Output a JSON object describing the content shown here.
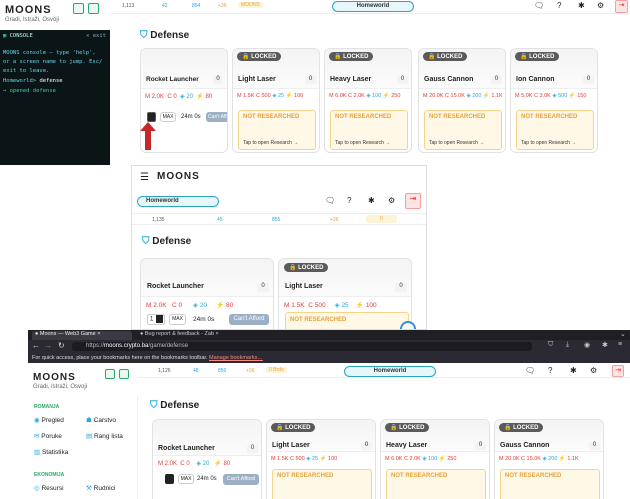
{
  "shot1": {
    "brand": "MOONS",
    "sub": "Gradi, Istraži, Osvoji",
    "console": {
      "title": "CONSOLE",
      "exit": "exit",
      "line1": "MOONS console — type 'help',",
      "line2": "or a screen name to jump. Esc/",
      "line3": "exit to leave.",
      "prompt": "Homeworld>",
      "cmd": "defense",
      "out": "→ opened defense"
    },
    "stats": [
      "1,113",
      "42",
      "854",
      "+36",
      "MOONS"
    ],
    "pill": "Homeworld",
    "section": "Defense",
    "cards": [
      {
        "name": "Rocket Launcher",
        "count": "0",
        "costs": [
          "2.0K",
          "0",
          "20",
          "80"
        ]
      },
      {
        "name": "Light Laser",
        "count": "0",
        "locked": "LOCKED",
        "costs": [
          "1.5K",
          "500",
          "25",
          "100"
        ]
      },
      {
        "name": "Heavy Laser",
        "count": "0",
        "locked": "LOCKED",
        "costs": [
          "6.0K",
          "2.0K",
          "100",
          "250"
        ]
      },
      {
        "name": "Gauss Cannon",
        "count": "0",
        "locked": "LOCKED",
        "costs": [
          "20.0K",
          "15.0K",
          "200",
          "1.1K"
        ]
      },
      {
        "name": "Ion Cannon",
        "count": "0",
        "locked": "LOCKED",
        "costs": [
          "5.0K",
          "3.0K",
          "500",
          "150"
        ]
      }
    ],
    "max": "MAX",
    "time": "24m 0s",
    "afford": "Can't Afford",
    "nr": "NOT RESEARCHED",
    "tap": "Tap to open Research →"
  },
  "shot2": {
    "brand": "MOONS",
    "pill": "Homeworld",
    "stats": [
      "1,135",
      "45",
      "855",
      "+36",
      "0"
    ],
    "section": "Defense",
    "cards": [
      {
        "name": "Rocket Launcher",
        "count": "0",
        "costs": [
          "2.0K",
          "0",
          "20",
          "80"
        ]
      },
      {
        "name": "Light Laser",
        "count": "0",
        "locked": "LOCKED",
        "costs": [
          "1.5K",
          "500",
          "25",
          "100"
        ]
      }
    ],
    "qty": "1",
    "max": "MAX",
    "time": "24m 0s",
    "afford": "Can't Afford",
    "nr": "NOT RESEARCHED"
  },
  "shot3": {
    "tabs": [
      "Moons — Web3 Game",
      "Bug report & feedback - Zab"
    ],
    "url_pre": "https://",
    "url_host": "moons.crypto.ba",
    "url_path": "/game/defense",
    "bookmarks": "For quick access, place your bookmarks here on the bookmarks toolbar.",
    "bm_link": "Manage bookmarks…",
    "brand": "MOONS",
    "sub": "Gradi, Istraži, Osvoji",
    "stats": [
      "1,126",
      "48",
      "856",
      "+36",
      "0 Brdo"
    ],
    "pill": "Homeworld",
    "nav_head": "ROMANJA",
    "nav": [
      "Pregled",
      "Carstvo",
      "Poruke",
      "Rang lista",
      "Statistika"
    ],
    "nav_head2": "EKONOMIJA",
    "nav2": [
      "Resursi",
      "Rudnici"
    ],
    "section": "Defense",
    "cards": [
      {
        "name": "Rocket Launcher",
        "count": "0",
        "costs": [
          "2.0K",
          "0",
          "20",
          "80"
        ]
      },
      {
        "name": "Light Laser",
        "count": "0",
        "locked": "LOCKED",
        "costs": [
          "1.5K",
          "500",
          "25",
          "100"
        ]
      },
      {
        "name": "Heavy Laser",
        "count": "0",
        "locked": "LOCKED",
        "costs": [
          "6.0K",
          "2.0K",
          "100",
          "250"
        ]
      },
      {
        "name": "Gauss Cannon",
        "count": "0",
        "locked": "LOCKED",
        "costs": [
          "20.0K",
          "15.0K",
          "200",
          "1.1K"
        ]
      }
    ],
    "max": "MAX",
    "time": "24m 0s",
    "afford": "Can't Afford",
    "nr": "NOT RESEARCHED"
  },
  "colors": {
    "accent": "#2aa6c4",
    "danger": "#e53935",
    "warn": "#e6a23c"
  }
}
